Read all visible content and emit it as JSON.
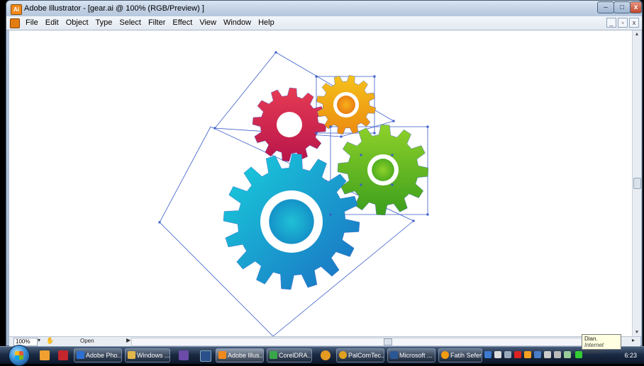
{
  "window": {
    "title": "Adobe Illustrator - [gear.ai @ 100% (RGB/Preview) ]",
    "app_badge": "Ai",
    "controls": {
      "minimize": "–",
      "maximize": "□",
      "close": "x"
    }
  },
  "menu": {
    "items": [
      "File",
      "Edit",
      "Object",
      "Type",
      "Select",
      "Filter",
      "Effect",
      "View",
      "Window",
      "Help"
    ],
    "doc_controls": [
      "_",
      "▫",
      "x"
    ]
  },
  "canvas": {
    "gears": [
      {
        "name": "red-gear",
        "color_top": "#e63b54",
        "color_bottom": "#b8154a"
      },
      {
        "name": "orange-gear",
        "color_top": "#f5c21b",
        "color_bottom": "#ec8a10"
      },
      {
        "name": "green-gear",
        "color_top": "#8fd12a",
        "color_bottom": "#3b9e1c"
      },
      {
        "name": "cyan-gear",
        "color_top": "#19c6d6",
        "color_bottom": "#1a73c4"
      }
    ],
    "selection_color": "#3a5dc9"
  },
  "status": {
    "zoom": "100%",
    "text": "Open"
  },
  "tooltip": {
    "title": "Dian.",
    "subtitle": "Internet access"
  },
  "taskbar": {
    "buttons": [
      {
        "label": "Adobe Pho...",
        "icon_color": "#2c6fd1"
      },
      {
        "label": "Windows ...",
        "icon_color": "#e1b64a"
      },
      {
        "label": "Adobe Illus...",
        "icon_color": "#f08a1c"
      },
      {
        "label": "CorelDRA...",
        "icon_color": "#3aa64a"
      },
      {
        "label": "PalComTec...",
        "icon_color": "#e0a020"
      },
      {
        "label": "Microsoft ...",
        "icon_color": "#2b5797"
      },
      {
        "label": "Fatih Sefera...",
        "icon_color": "#f39c12"
      }
    ],
    "clock": "6:23"
  }
}
